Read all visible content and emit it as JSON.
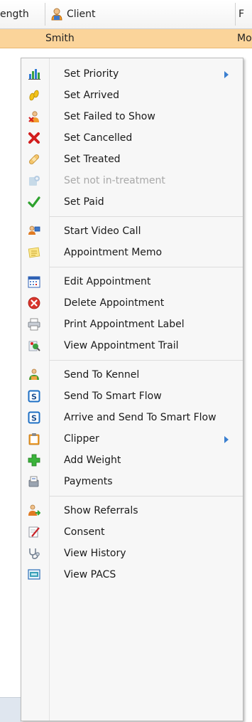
{
  "grid": {
    "columns": {
      "length": "ength",
      "client": "Client",
      "next": "F"
    },
    "row": {
      "client": "Smith",
      "next": "Mo"
    }
  },
  "menu": {
    "groups": [
      [
        {
          "label": "Set Priority",
          "icon": "bar-chart-icon",
          "submenu": true,
          "disabled": false
        },
        {
          "label": "Set Arrived",
          "icon": "footprints-icon",
          "submenu": false,
          "disabled": false
        },
        {
          "label": "Set Failed to Show",
          "icon": "person-cross-icon",
          "submenu": false,
          "disabled": false
        },
        {
          "label": "Set Cancelled",
          "icon": "red-x-icon",
          "submenu": false,
          "disabled": false
        },
        {
          "label": "Set Treated",
          "icon": "bandage-icon",
          "submenu": false,
          "disabled": false
        },
        {
          "label": "Set not in-treatment",
          "icon": "treatment-icon",
          "submenu": false,
          "disabled": true
        },
        {
          "label": "Set Paid",
          "icon": "checkmark-icon",
          "submenu": false,
          "disabled": false
        }
      ],
      [
        {
          "label": "Start Video Call",
          "icon": "video-call-icon",
          "submenu": false,
          "disabled": false
        },
        {
          "label": "Appointment Memo",
          "icon": "memo-icon",
          "submenu": false,
          "disabled": false
        }
      ],
      [
        {
          "label": "Edit Appointment",
          "icon": "calendar-icon",
          "submenu": false,
          "disabled": false
        },
        {
          "label": "Delete Appointment",
          "icon": "delete-icon",
          "submenu": false,
          "disabled": false
        },
        {
          "label": "Print Appointment Label",
          "icon": "printer-icon",
          "submenu": false,
          "disabled": false
        },
        {
          "label": "View Appointment Trail",
          "icon": "trail-icon",
          "submenu": false,
          "disabled": false
        }
      ],
      [
        {
          "label": "Send To Kennel",
          "icon": "kennel-icon",
          "submenu": false,
          "disabled": false
        },
        {
          "label": "Send To Smart Flow",
          "icon": "smart-flow-icon",
          "submenu": false,
          "disabled": false
        },
        {
          "label": "Arrive and Send To Smart Flow",
          "icon": "smart-flow-icon",
          "submenu": false,
          "disabled": false
        },
        {
          "label": "Clipper",
          "icon": "clipboard-icon",
          "submenu": true,
          "disabled": false
        },
        {
          "label": "Add Weight",
          "icon": "plus-icon",
          "submenu": false,
          "disabled": false
        },
        {
          "label": "Payments",
          "icon": "payments-icon",
          "submenu": false,
          "disabled": false
        }
      ],
      [
        {
          "label": "Show Referrals",
          "icon": "referrals-icon",
          "submenu": false,
          "disabled": false
        },
        {
          "label": "Consent",
          "icon": "consent-icon",
          "submenu": false,
          "disabled": false
        },
        {
          "label": "View History",
          "icon": "stethoscope-icon",
          "submenu": false,
          "disabled": false
        },
        {
          "label": "View PACS",
          "icon": "pacs-icon",
          "submenu": false,
          "disabled": false
        }
      ]
    ]
  },
  "colors": {
    "selected_row": "#fbd49a",
    "submenu_arrow": "#3a7fd0",
    "menu_bg": "#f7f7f7"
  }
}
